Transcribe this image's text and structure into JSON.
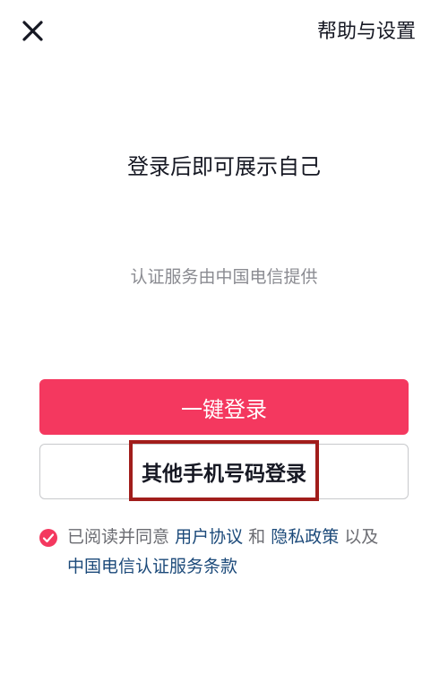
{
  "header": {
    "help_settings_label": "帮助与设置"
  },
  "main": {
    "title": "登录后即可展示自己",
    "provider_text": "认证服务由中国电信提供",
    "one_click_login_label": "一键登录",
    "other_phone_login_label": "其他手机号码登录"
  },
  "agreement": {
    "checked": true,
    "prefix": "已阅读并同意",
    "user_agreement": "用户协议",
    "and": "和",
    "privacy_policy": "隐私政策",
    "and_also": "以及",
    "telecom_terms": "中国电信认证服务条款"
  },
  "colors": {
    "accent": "#f4385f",
    "highlight_border": "#a11d1b",
    "link": "#1c4a7a"
  }
}
